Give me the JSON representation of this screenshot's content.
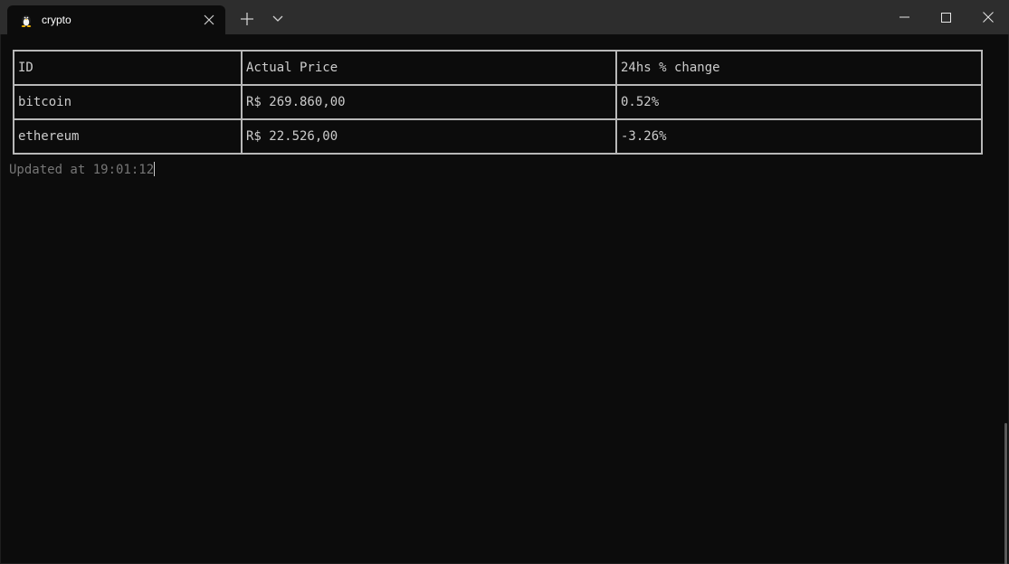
{
  "window": {
    "tab_title": "crypto",
    "tab_icon": "linux-penguin-icon"
  },
  "table": {
    "headers": [
      "ID",
      "Actual Price",
      "24hs % change"
    ],
    "rows": [
      {
        "id": "bitcoin",
        "price": "R$ 269.860,00",
        "change": "0.52%",
        "change_color": "#16c60c"
      },
      {
        "id": "ethereum",
        "price": "R$ 22.526,00",
        "change": "-3.26%",
        "change_color": "#f16f58"
      }
    ]
  },
  "status": {
    "updated_text": "Updated at 19:01:12"
  },
  "colors": {
    "positive": "#16c60c",
    "negative": "#f16f58",
    "background": "#0c0c0c",
    "titlebar": "#2d2d2d"
  }
}
